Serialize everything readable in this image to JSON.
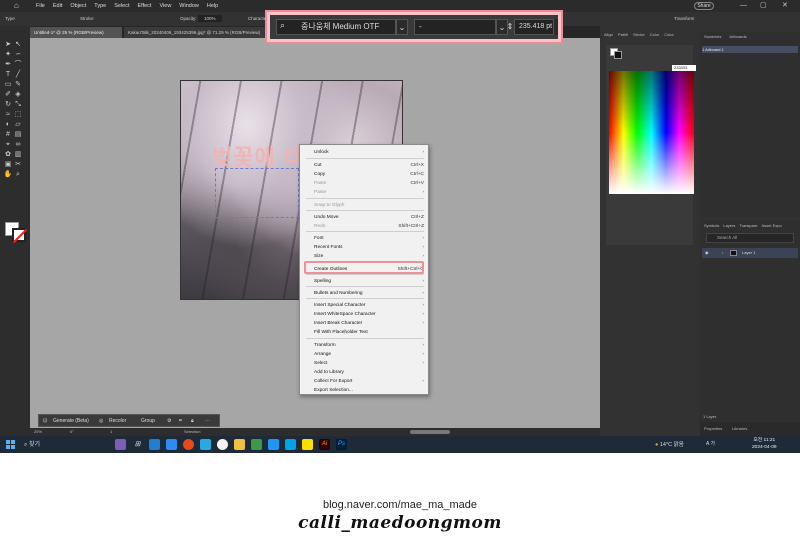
{
  "menubar": {
    "items": [
      "File",
      "Edit",
      "Object",
      "Type",
      "Select",
      "Effect",
      "View",
      "Window",
      "Help"
    ],
    "share": "Share"
  },
  "control_bar": {
    "label_type": "Type",
    "stroke_label": "Stroke:",
    "opacity_label": "Opacity:",
    "opacity_value": "100%",
    "character_label": "Characte",
    "transform_label": "Transform"
  },
  "tabs": [
    {
      "label": "Untitled-1* @ 25 % (RGB/Preview)"
    },
    {
      "label": "KakaoTalk_20240409_193425396.jpg* @ 71.29 % (RGB/Preview)"
    }
  ],
  "artwork_text": "벚꽃에 대한",
  "font_bar": {
    "font_name": "중나움체 Medium OTF",
    "font_style": "-",
    "font_size": "235.418 pt"
  },
  "context_menu": {
    "items": [
      {
        "label": "Unlock",
        "shortcut": "",
        "submenu": true,
        "disabled": false
      },
      {
        "label": "Cut",
        "shortcut": "Ctrl+X",
        "submenu": false,
        "disabled": false
      },
      {
        "label": "Copy",
        "shortcut": "Ctrl+C",
        "submenu": false,
        "disabled": false
      },
      {
        "label": "Paste",
        "shortcut": "Ctrl+V",
        "submenu": false,
        "disabled": true
      },
      {
        "label": "Paste",
        "shortcut": "",
        "submenu": true,
        "disabled": true
      },
      {
        "label": "Snap to Glyph",
        "shortcut": "",
        "submenu": false,
        "disabled": true
      },
      {
        "label": "Undo Move",
        "shortcut": "Ctrl+Z",
        "submenu": false,
        "disabled": false
      },
      {
        "label": "Redo",
        "shortcut": "Shift+Ctrl+Z",
        "submenu": false,
        "disabled": true
      },
      {
        "label": "Font",
        "shortcut": "",
        "submenu": true,
        "disabled": false
      },
      {
        "label": "Recent Fonts",
        "shortcut": "",
        "submenu": true,
        "disabled": false
      },
      {
        "label": "Size",
        "shortcut": "",
        "submenu": true,
        "disabled": false
      },
      {
        "label": "Create Outlines",
        "shortcut": "Shift+Ctrl+O",
        "submenu": false,
        "disabled": false
      },
      {
        "label": "Spelling",
        "shortcut": "",
        "submenu": true,
        "disabled": false
      },
      {
        "label": "Bullets and Numbering",
        "shortcut": "",
        "submenu": true,
        "disabled": false
      },
      {
        "label": "Insert Special Character",
        "shortcut": "",
        "submenu": true,
        "disabled": false
      },
      {
        "label": "Insert WhiteSpace Character",
        "shortcut": "",
        "submenu": true,
        "disabled": false
      },
      {
        "label": "Insert Break Character",
        "shortcut": "",
        "submenu": true,
        "disabled": false
      },
      {
        "label": "Fill With Placeholder Text",
        "shortcut": "",
        "submenu": false,
        "disabled": false
      },
      {
        "label": "Transform",
        "shortcut": "",
        "submenu": true,
        "disabled": false
      },
      {
        "label": "Arrange",
        "shortcut": "",
        "submenu": true,
        "disabled": false
      },
      {
        "label": "Select",
        "shortcut": "",
        "submenu": true,
        "disabled": false
      },
      {
        "label": "Add to Library",
        "shortcut": "",
        "submenu": false,
        "disabled": false
      },
      {
        "label": "Collect For Export",
        "shortcut": "",
        "submenu": true,
        "disabled": false
      },
      {
        "label": "Export Selection...",
        "shortcut": "",
        "submenu": false,
        "disabled": false
      }
    ]
  },
  "float_bar": {
    "generate": "Generate (Beta)",
    "recolor": "Recolor",
    "group": "Group"
  },
  "status": {
    "zoom": "25%",
    "angle": "0°",
    "page": "1",
    "selection": "Selection"
  },
  "color_panel": {
    "tabs": [
      "Align",
      "Pathfi",
      "Stroke",
      "Color",
      "Color"
    ],
    "hex": "233333"
  },
  "artboards_panel": {
    "tabs": [
      "Swatches",
      "Artboards"
    ],
    "row": "1   Artboard 1"
  },
  "layers_panel": {
    "tabs": [
      "Symbols",
      "Layers",
      "Transpare",
      "Asset Expo"
    ],
    "search_placeholder": "Search All",
    "layer_name": "Layer 1",
    "footer": "1 Layer"
  },
  "bottom_tabs": [
    "Properties",
    "Libraries"
  ],
  "taskbar": {
    "search": "찾기",
    "weather": "14°C 맑음",
    "ime": "A 가",
    "time_ampm": "오전 11:21",
    "date": "2024-04-09"
  },
  "footer": {
    "blog": "blog.naver.com/mae_ma_made",
    "signature": "calli_maedoongmom"
  },
  "colors": {
    "highlight": "#ef8f98",
    "canvas": "#a6a6a6",
    "ui_dark": "#323232"
  }
}
